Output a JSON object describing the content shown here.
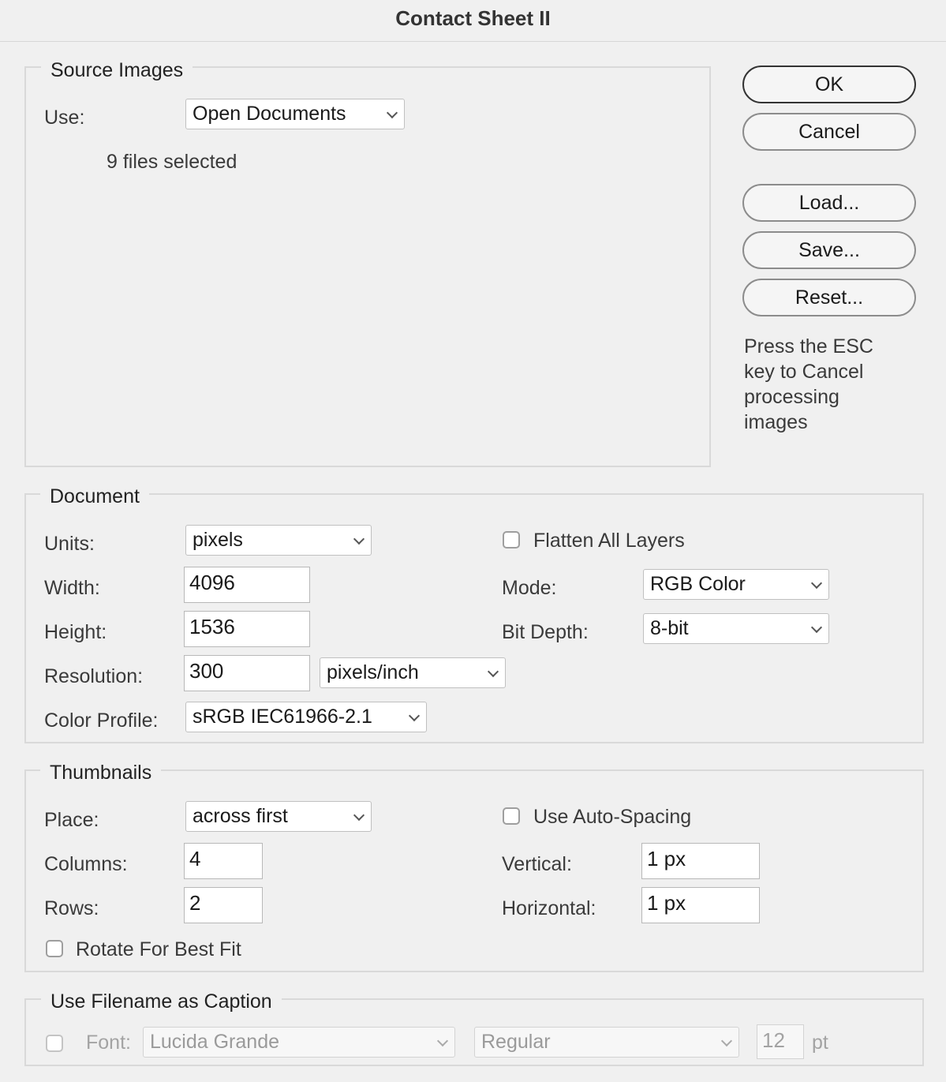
{
  "window": {
    "title": "Contact Sheet II"
  },
  "source_images": {
    "group_title": "Source Images",
    "use_label": "Use:",
    "use_value": "Open Documents",
    "files_selected": "9 files selected"
  },
  "buttons": {
    "ok": "OK",
    "cancel": "Cancel",
    "load": "Load...",
    "save": "Save...",
    "reset": "Reset..."
  },
  "esc_note": [
    "Press the ESC",
    "key to Cancel",
    "processing",
    "images"
  ],
  "document": {
    "group_title": "Document",
    "units_label": "Units:",
    "units_value": "pixels",
    "width_label": "Width:",
    "width_value": "4096",
    "height_label": "Height:",
    "height_value": "1536",
    "resolution_label": "Resolution:",
    "resolution_value": "300",
    "resolution_unit": "pixels/inch",
    "color_profile_label": "Color Profile:",
    "color_profile_value": "sRGB IEC61966-2.1",
    "flatten_label": "Flatten All Layers",
    "flatten_checked": false,
    "mode_label": "Mode:",
    "mode_value": "RGB Color",
    "bit_depth_label": "Bit Depth:",
    "bit_depth_value": "8-bit"
  },
  "thumbnails": {
    "group_title": "Thumbnails",
    "place_label": "Place:",
    "place_value": "across first",
    "columns_label": "Columns:",
    "columns_value": "4",
    "rows_label": "Rows:",
    "rows_value": "2",
    "rotate_label": "Rotate For Best Fit",
    "rotate_checked": false,
    "auto_spacing_label": "Use Auto-Spacing",
    "auto_spacing_checked": false,
    "vertical_label": "Vertical:",
    "vertical_value": "1 px",
    "horizontal_label": "Horizontal:",
    "horizontal_value": "1 px"
  },
  "caption": {
    "group_title": "Use Filename as Caption",
    "enabled": false,
    "font_label": "Font:",
    "font_value": "Lucida Grande",
    "style_value": "Regular",
    "size_value": "12",
    "size_unit": "pt"
  }
}
